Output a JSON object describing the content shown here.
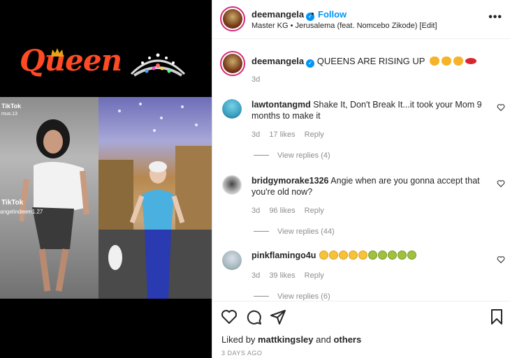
{
  "media": {
    "queen_text": "Queen",
    "tiktok_label": "TikTok",
    "tiktok_user_fragment": "mus.13",
    "tiktok_logo_text": "TikTok",
    "tiktok_handle": "angelindeem1.27"
  },
  "header": {
    "username": "deemangela",
    "separator": "•",
    "follow_label": "Follow",
    "subtitle": "Master KG • Jerusalema (feat. Nomcebo Zikode) [Edit]",
    "more_label": "•••"
  },
  "caption": {
    "username": "deemangela",
    "text": "QUEENS ARE RISING UP",
    "time": "3d"
  },
  "comments": [
    {
      "username": "lawtontangmd",
      "text": "Shake It, Don't Break It...it took your Mom 9 months to make it",
      "time": "3d",
      "likes": "17 likes",
      "reply_label": "Reply",
      "view_replies": "View replies (4)"
    },
    {
      "username": "bridgymorake1326",
      "text": "Angie when are you gonna accept that you're old now?",
      "time": "3d",
      "likes": "96 likes",
      "reply_label": "Reply",
      "view_replies": "View replies (44)"
    },
    {
      "username": "pinkflamingo4u",
      "text": "",
      "time": "3d",
      "likes": "39 likes",
      "reply_label": "Reply",
      "view_replies": "View replies (6)"
    }
  ],
  "footer": {
    "liked_by_prefix": "Liked by",
    "liked_by_user": "mattkingsley",
    "liked_by_and": "and",
    "liked_by_others": "others",
    "date": "3 DAYS AGO"
  },
  "colors": {
    "accent": "#0095f6",
    "ring": "#d62976",
    "queen": "#ff4a24"
  },
  "icons": [
    "verified-badge-icon",
    "more-options-icon",
    "heart-icon",
    "comment-icon",
    "share-icon",
    "bookmark-icon"
  ]
}
